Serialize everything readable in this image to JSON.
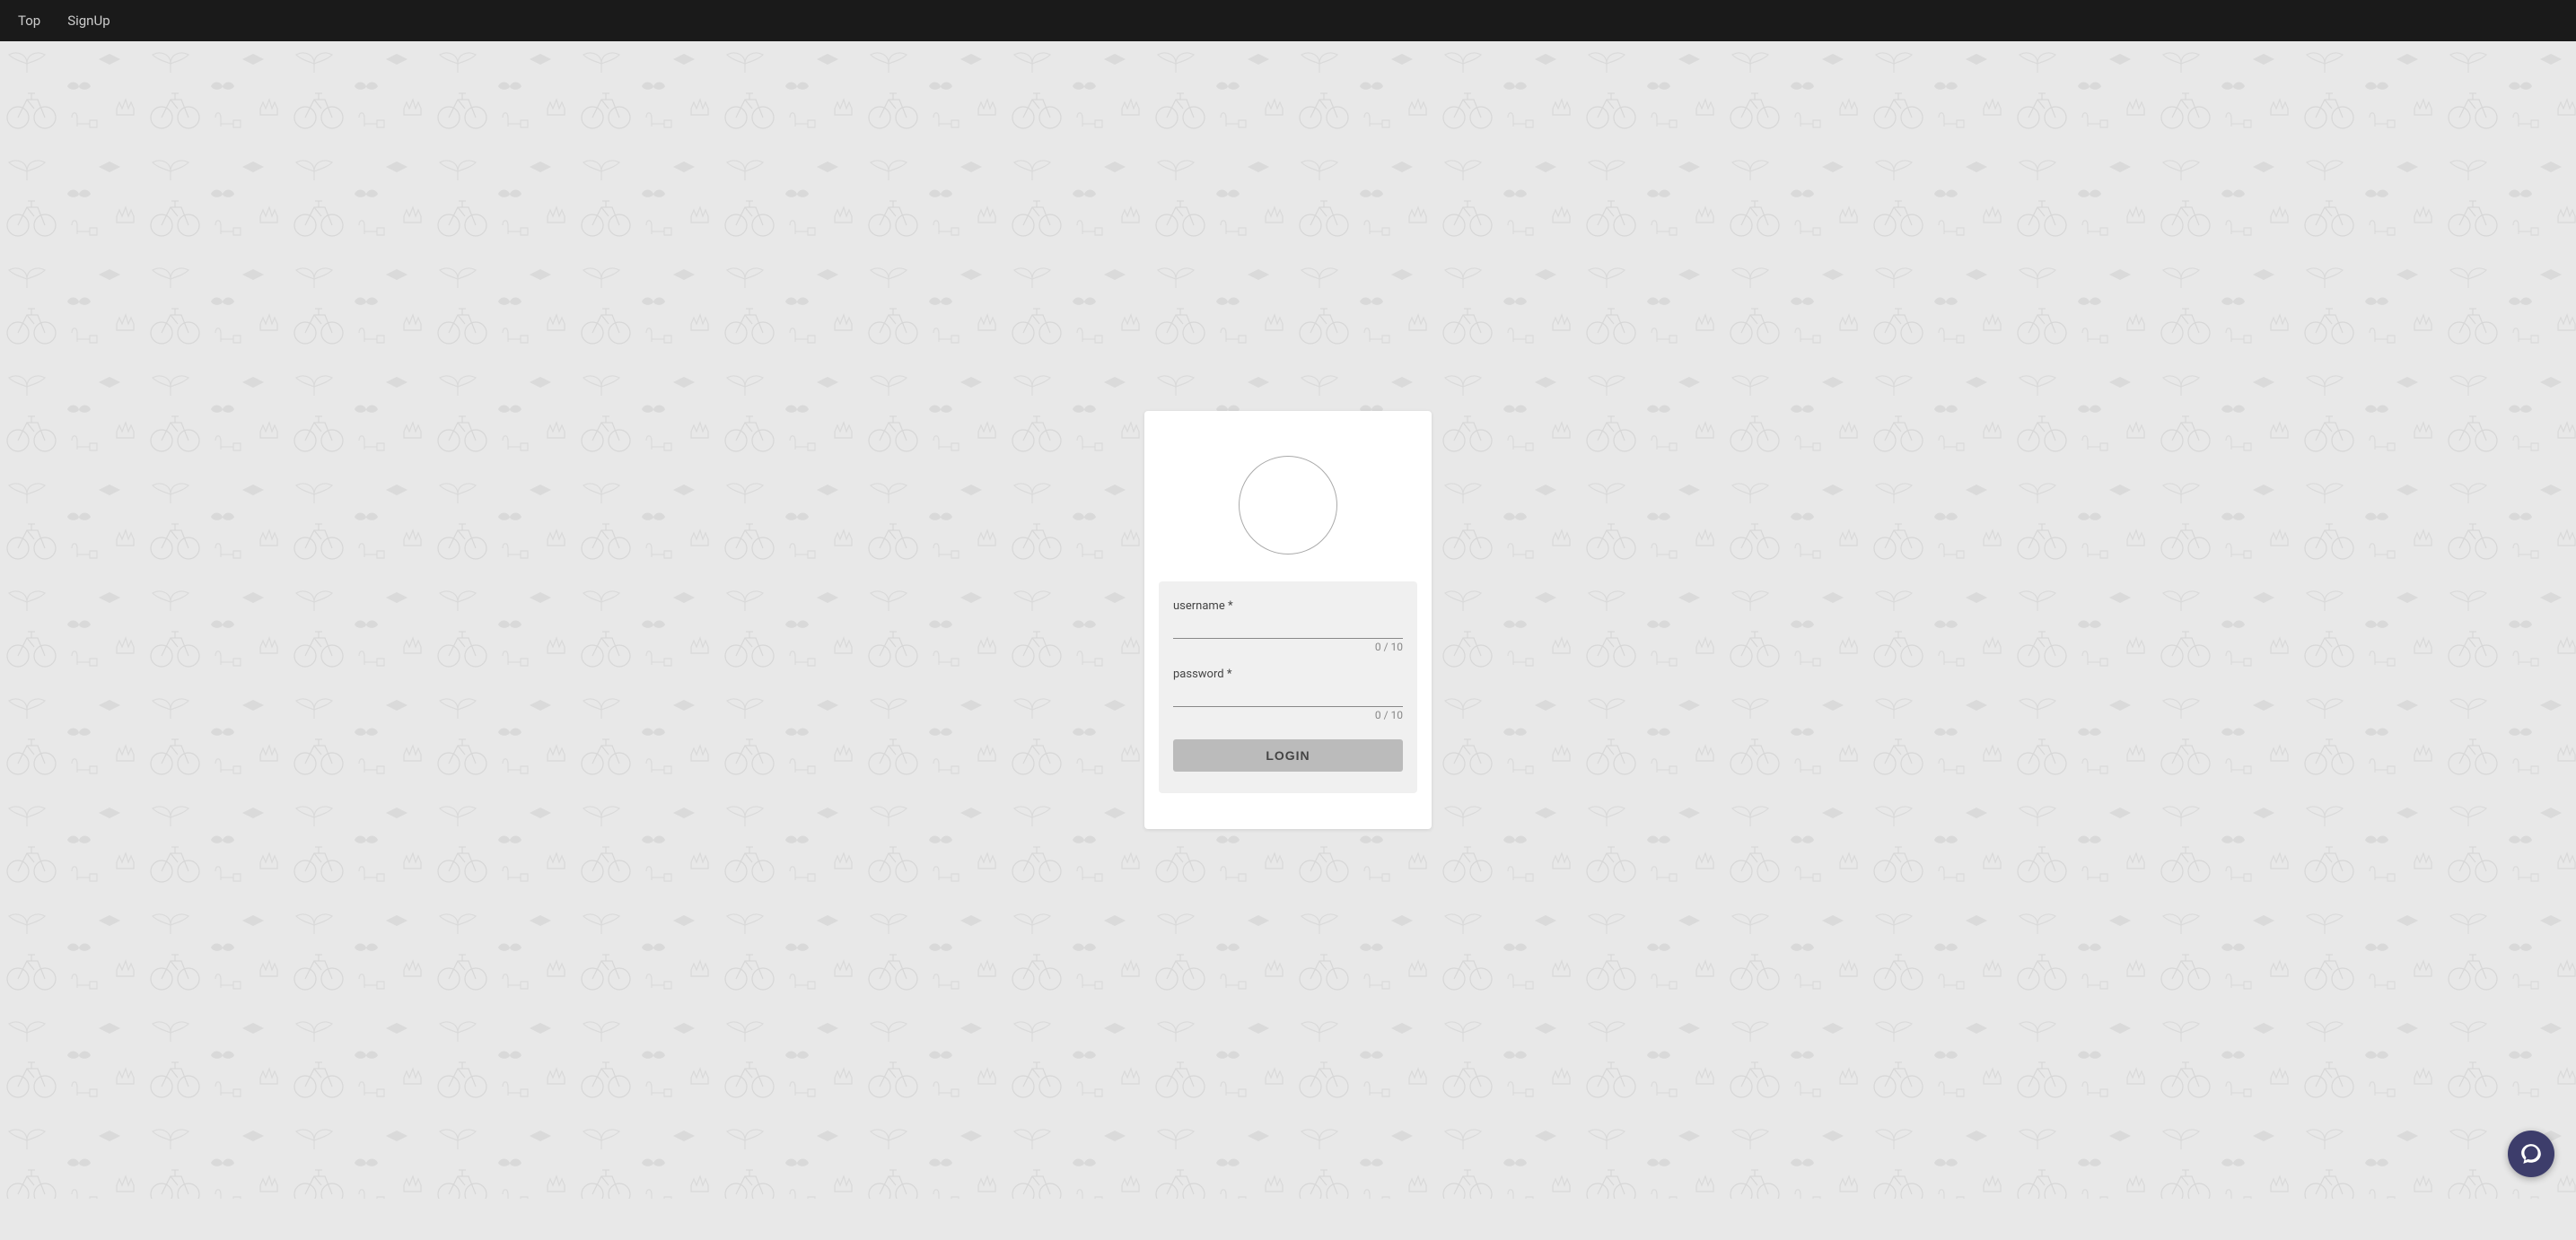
{
  "navbar": {
    "top_label": "Top",
    "signup_label": "SignUp"
  },
  "login_card": {
    "username_label": "username *",
    "username_count": "0 / 10",
    "password_label": "password *",
    "password_count": "0 / 10",
    "login_button": "LOGIN"
  },
  "chat_button": {
    "icon": "chat-icon"
  },
  "colors": {
    "navbar_bg": "#1a1a1a",
    "background": "#e8e8e8",
    "card_bg": "#ffffff",
    "form_bg": "#f0f0f0",
    "chat_btn": "#3d3d6b"
  }
}
